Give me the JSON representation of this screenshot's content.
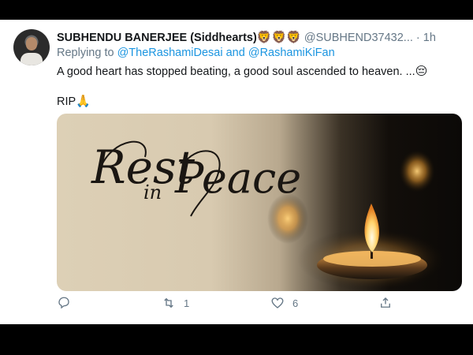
{
  "tweet": {
    "name": "SUBHENDU BANERJEE (Siddhearts)",
    "name_emojis": "🦁🦁🦁",
    "handle": "@SUBHEND37432...",
    "separator": "·",
    "time": "1h",
    "replying_prefix": "Replying to",
    "mention1": "@TheRashamiDesai",
    "and_text": "and",
    "mention2": "@RashamiKiFan",
    "text_line1": "A good heart has stopped beating, a good soul ascended to heaven. ...",
    "text_line1_emoji": "😔",
    "text_line2": "RIP",
    "text_line2_emoji": "🙏",
    "media": {
      "line1": "Rest",
      "line2": "in",
      "line3": "Peace"
    },
    "actions": {
      "reply_icon": "reply-icon",
      "retweet_icon": "retweet-icon",
      "retweet_count": "1",
      "like_icon": "heart-icon",
      "like_count": "6",
      "share_icon": "share-icon"
    }
  }
}
